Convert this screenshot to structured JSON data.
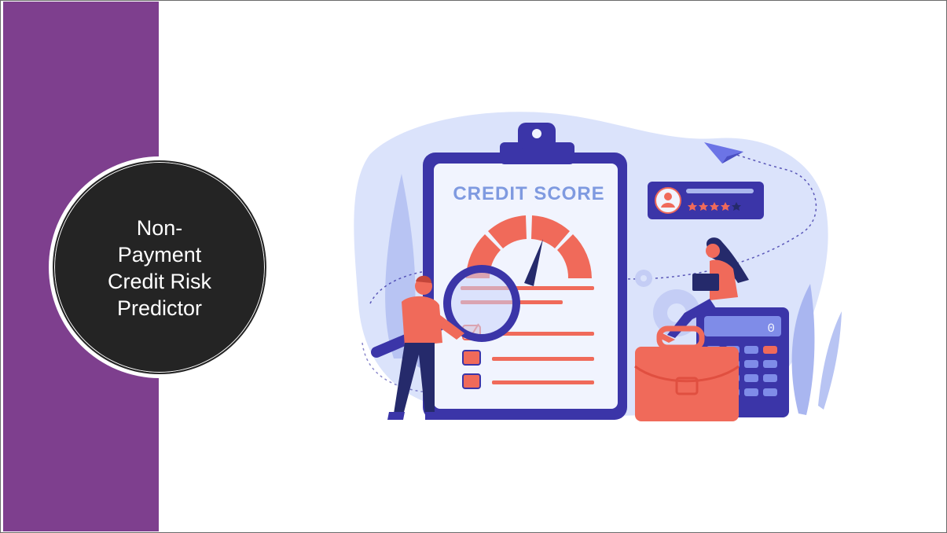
{
  "slide": {
    "title": "Non-Payment Credit Risk Predictor",
    "title_lines": [
      "Non-",
      "Payment",
      "Credit Risk",
      "Predictor"
    ]
  },
  "illustration": {
    "heading": "CREDIT SCORE",
    "calculator_display": "0",
    "rating": 4,
    "rating_max": 5
  },
  "colors": {
    "sidebar": "#7e3f8e",
    "badge": "#242424",
    "navy": "#3b35a8",
    "coral": "#f06a5a",
    "light_blue": "#dbe3fb"
  }
}
